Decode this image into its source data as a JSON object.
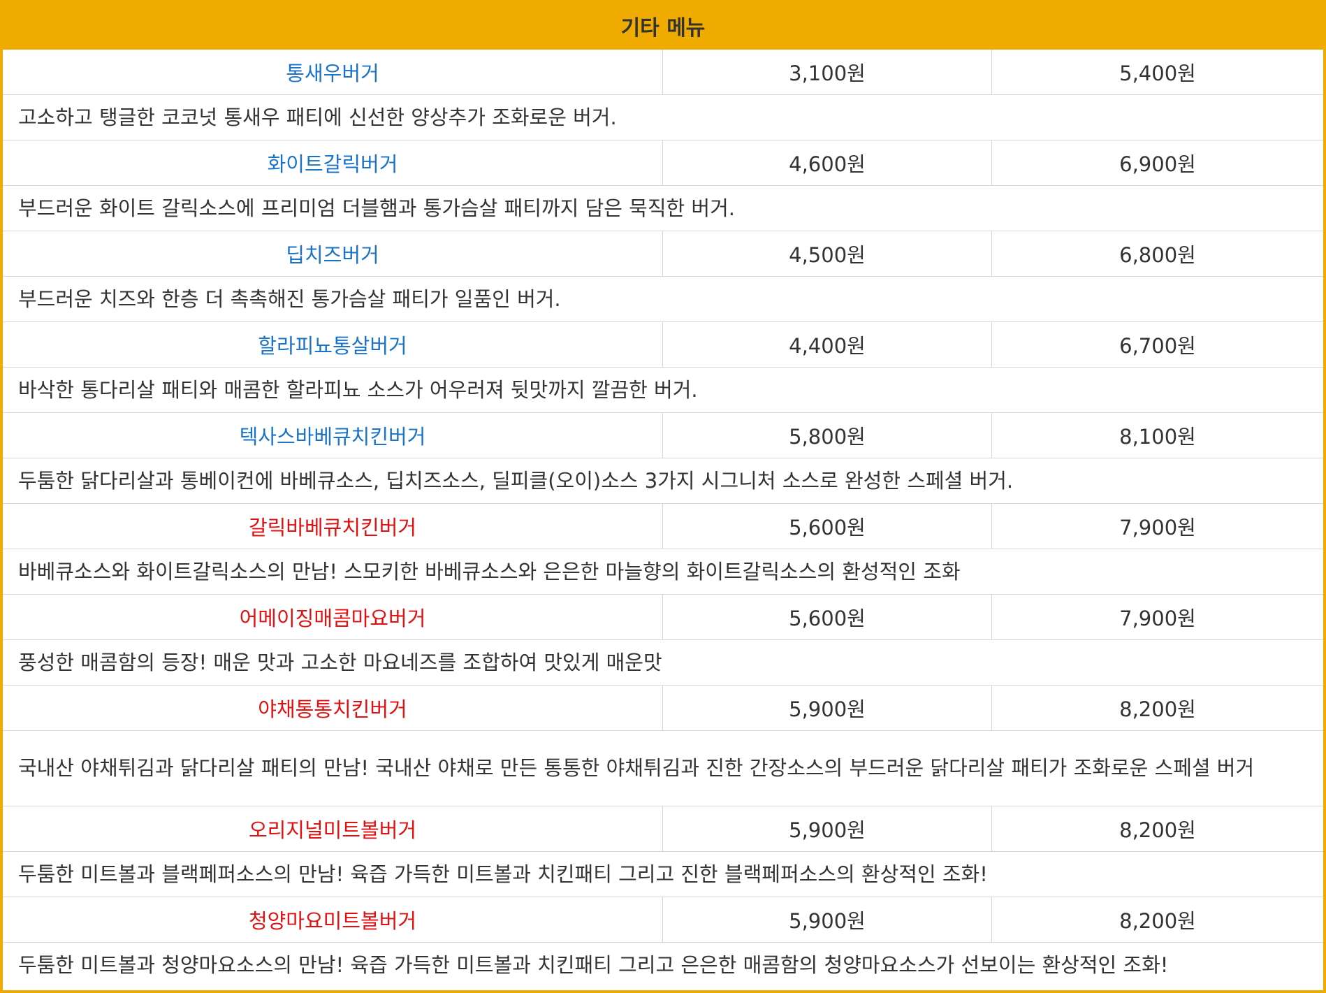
{
  "table": {
    "header": "기타 메뉴",
    "colors": {
      "header_bg": "#f0ab00",
      "name_blue": "#1a73c7",
      "name_red": "#e01010",
      "text": "#333333",
      "border": "#d6d6d6"
    },
    "items": [
      {
        "name": "통새우버거",
        "color": "#1a73c7",
        "single_price": "3,100원",
        "set_price": "5,400원",
        "description": "고소하고 탱글한 코코넛 통새우 패티에 신선한 양상추가 조화로운 버거."
      },
      {
        "name": "화이트갈릭버거",
        "color": "#1a73c7",
        "single_price": "4,600원",
        "set_price": "6,900원",
        "description": "부드러운 화이트 갈릭소스에 프리미엄 더블햄과 통가슴살 패티까지 담은 묵직한 버거."
      },
      {
        "name": "딥치즈버거",
        "color": "#1a73c7",
        "single_price": "4,500원",
        "set_price": "6,800원",
        "description": "부드러운 치즈와 한층 더 촉촉해진 통가슴살 패티가 일품인 버거."
      },
      {
        "name": "할라피뇨통살버거",
        "color": "#1a73c7",
        "single_price": "4,400원",
        "set_price": "6,700원",
        "description": "바삭한 통다리살 패티와 매콤한 할라피뇨 소스가 어우러져 뒷맛까지 깔끔한 버거."
      },
      {
        "name": "텍사스바베큐치킨버거",
        "color": "#1a73c7",
        "single_price": "5,800원",
        "set_price": "8,100원",
        "description": "두툼한 닭다리살과 통베이컨에 바베큐소스, 딥치즈소스, 딜피클(오이)소스 3가지 시그니처 소스로 완성한 스페셜 버거."
      },
      {
        "name": "갈릭바베큐치킨버거",
        "color": "#e01010",
        "single_price": "5,600원",
        "set_price": "7,900원",
        "description": "바베큐소스와 화이트갈릭소스의 만남! 스모키한 바베큐소스와 은은한 마늘향의 화이트갈릭소스의 환성적인 조화"
      },
      {
        "name": "어메이징매콤마요버거",
        "color": "#e01010",
        "single_price": "5,600원",
        "set_price": "7,900원",
        "description": "풍성한 매콤함의 등장! 매운 맛과 고소한 마요네즈를 조합하여 맛있게 매운맛"
      },
      {
        "name": "야채통통치킨버거",
        "color": "#e01010",
        "single_price": "5,900원",
        "set_price": "8,200원",
        "description": "국내산 야채튀김과 닭다리살 패티의 만남! 국내산 야채로 만든 통통한 야채튀김과 진한 간장소스의 부드러운 닭다리살 패티가 조화로운 스페셜 버거"
      },
      {
        "name": "오리지널미트볼버거",
        "color": "#e01010",
        "single_price": "5,900원",
        "set_price": "8,200원",
        "description": "두툼한 미트볼과 블랙페퍼소스의 만남! 육즙 가득한 미트볼과 치킨패티 그리고 진한 블랙페퍼소스의 환상적인 조화!"
      },
      {
        "name": "청양마요미트볼버거",
        "color": "#e01010",
        "single_price": "5,900원",
        "set_price": "8,200원",
        "description": "두툼한 미트볼과 청양마요소스의 만남! 육즙 가득한 미트볼과 치킨패티 그리고 은은한 매콤함의 청양마요소스가 선보이는 환상적인 조화!"
      }
    ]
  }
}
